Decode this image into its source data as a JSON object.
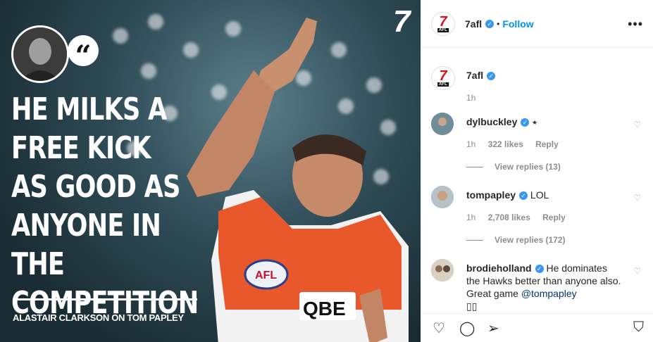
{
  "post_image": {
    "quote_mark": "“",
    "headline": "HE MILKS A\nFREE KICK\nAS GOOD AS\nANYONE IN THE\nCOMPETITION",
    "attribution": "ALASTAIR CLARKSON ON TOM PAPLEY",
    "channel_logo": "7"
  },
  "header": {
    "username": "7afl",
    "verified_mark": "✓",
    "dot": "•",
    "follow_label": "Follow",
    "more_icon": "•••",
    "logo_seven": "7",
    "logo_afl": "AFL"
  },
  "caption": {
    "username": "7afl",
    "verified_mark": "✓",
    "text": "",
    "time": "1h",
    "logo_seven": "7",
    "logo_afl": "AFL"
  },
  "comments": [
    {
      "username": "dylbuckley",
      "verified_mark": "✓",
      "text": "⭑",
      "time": "1h",
      "likes": "322 likes",
      "reply": "Reply",
      "view_replies": "View replies (13)"
    },
    {
      "username": "tompapley",
      "verified_mark": "✓",
      "text": "LOL",
      "time": "1h",
      "likes": "2,708 likes",
      "reply": "Reply",
      "view_replies": "View replies (172)"
    },
    {
      "username": "brodieholland",
      "verified_mark": "✓",
      "text": "He dominates the Hawks better than anyone also. Great game",
      "mention": "@tompapley",
      "text_tail": "▯▯"
    }
  ],
  "icons": {
    "heart": "♡",
    "like": "♡",
    "comment": "◯",
    "share": "➢",
    "bookmark": "⛉"
  },
  "colors": {
    "accent": "#0095f6",
    "verified": "#3897f0",
    "brand_red": "#d4141b",
    "muted": "#8e8e8e"
  }
}
